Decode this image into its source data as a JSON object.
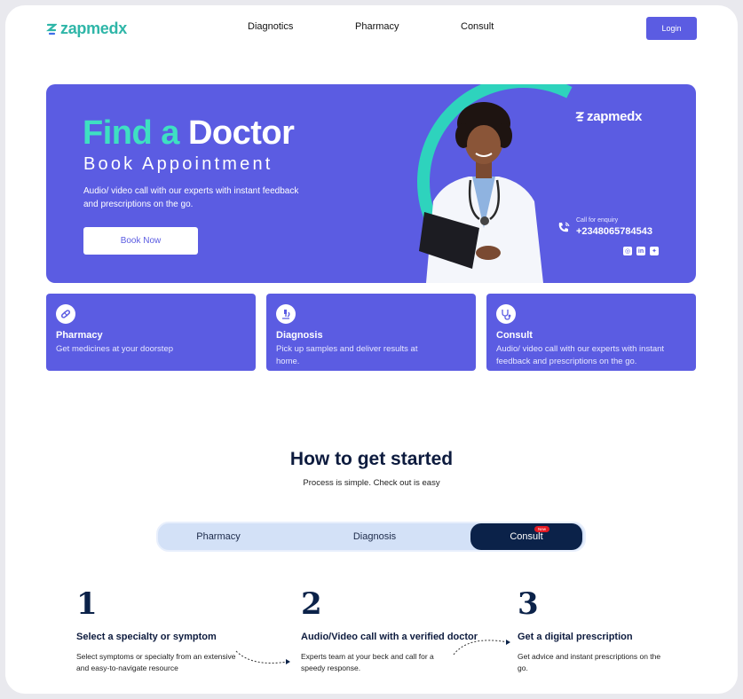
{
  "header": {
    "logo_text": "zapmedx",
    "nav": [
      "Diagnotics",
      "Pharmacy",
      "Consult"
    ],
    "login_label": "Login"
  },
  "hero": {
    "title_find": "Find a",
    "title_doctor": "Doctor",
    "subtitle": "Book Appointment",
    "description": "Audio/ video call with our experts with instant feedback and prescriptions on the go.",
    "book_label": "Book Now",
    "logo_text": "zapmedx",
    "call_label": "Call for enquiry",
    "phone": "+2348065784543",
    "socials": [
      "instagram-icon",
      "linkedin-icon",
      "twitter-icon"
    ]
  },
  "services": [
    {
      "title": "Pharmacy",
      "desc": "Get medicines at your doorstep",
      "icon": "pill-icon"
    },
    {
      "title": "Diagnosis",
      "desc": "Pick up samples and deliver results at home.",
      "icon": "microscope-icon"
    },
    {
      "title": "Consult",
      "desc": "Audio/ video call with our experts with instant feedback and prescriptions on the go.",
      "icon": "stethoscope-icon"
    }
  ],
  "how": {
    "title": "How to get started",
    "subtitle": "Process is simple. Check out is easy",
    "tabs": [
      "Pharmacy",
      "Diagnosis",
      "Consult"
    ],
    "active_tab": "Consult",
    "new_badge": "New",
    "steps": [
      {
        "num": "1",
        "title": "Select a specialty or symptom",
        "desc": "Select symptoms or specialty from an extensive and easy-to-navigate resource"
      },
      {
        "num": "2",
        "title": "Audio/Video call with a verified doctor",
        "desc": "Experts team at your beck and call for a speedy response."
      },
      {
        "num": "3",
        "title": "Get a digital prescription",
        "desc": "Get advice and instant prescriptions on the go."
      }
    ]
  },
  "colors": {
    "primary": "#5b5ce2",
    "accent": "#3ee0c2",
    "navy": "#0b2249"
  }
}
